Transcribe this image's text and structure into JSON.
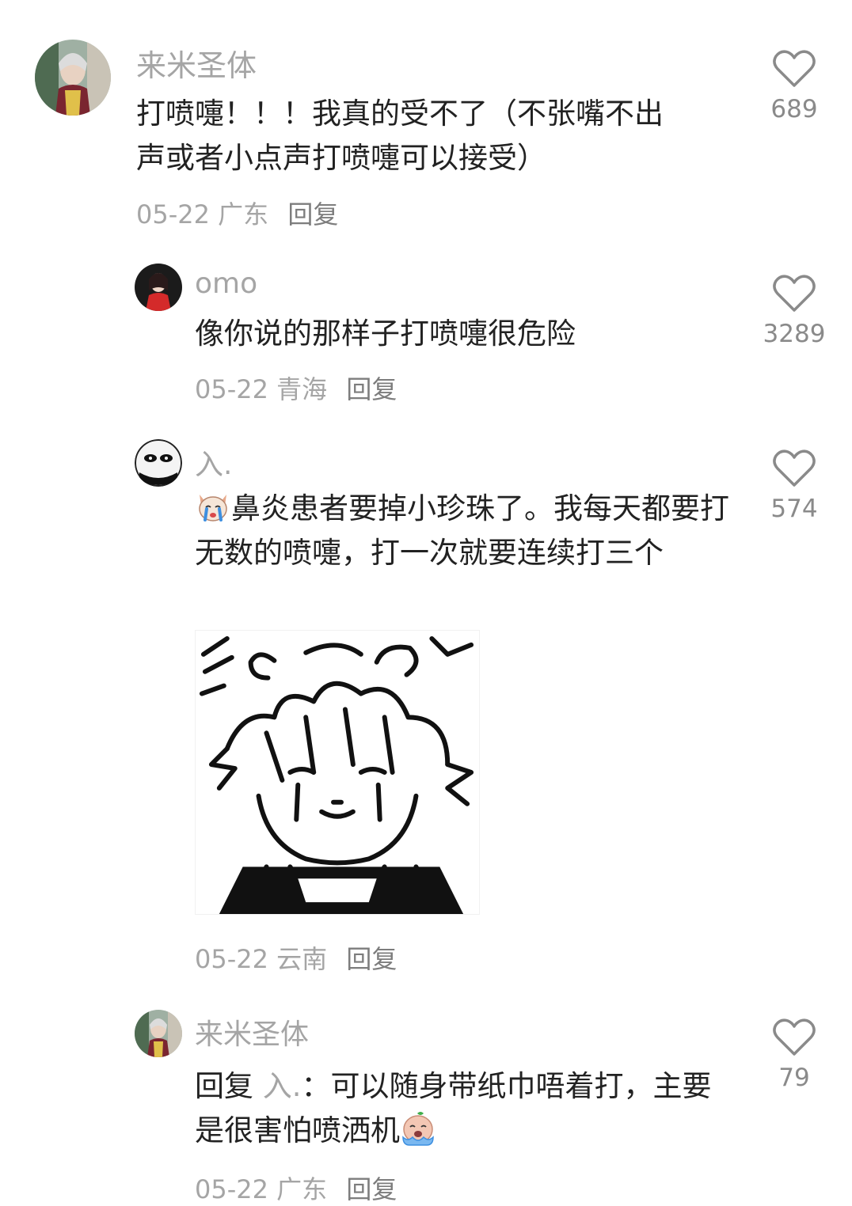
{
  "comments": [
    {
      "username": "来米圣体",
      "text": "打喷嚏！！！我真的受不了（不张嘴不出声或者小点声打喷嚏可以接受）",
      "date": "05-22",
      "location": "广东",
      "reply_label": "回复",
      "likes": "689"
    },
    {
      "username": "omo",
      "text": "像你说的那样子打喷嚏很危险",
      "date": "05-22",
      "location": "青海",
      "reply_label": "回复",
      "likes": "3289"
    },
    {
      "username": "入.",
      "emoji": "crying-dog-emoji",
      "text": "鼻炎患者要掉小珍珠了。我每天都要打无数的喷嚏，打一次就要连续打三个",
      "sticker": "crying-manga-boy-sticker",
      "date": "05-22",
      "location": "云南",
      "reply_label": "回复",
      "likes": "574"
    },
    {
      "username": "来米圣体",
      "reply_prefix": "回复",
      "mention": "入.",
      "text": "：可以随身带纸巾唔着打，主要是很害怕喷洒机",
      "emoji": "crying-face-emoji",
      "date": "05-22",
      "location": "广东",
      "reply_label": "回复",
      "likes": "79"
    }
  ],
  "colors": {
    "username": "#a5a5a5",
    "text": "#222222",
    "meta": "#a5a5a5",
    "like_icon": "#8a8a8a"
  }
}
